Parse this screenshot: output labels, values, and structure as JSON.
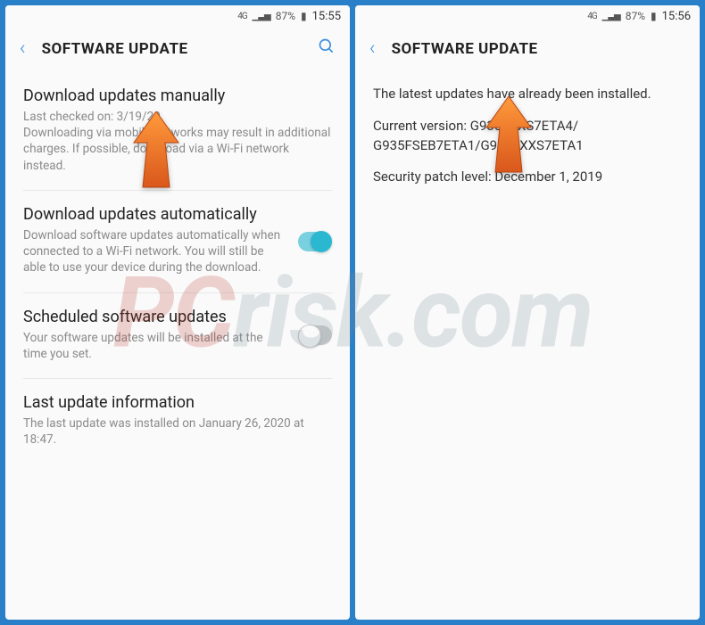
{
  "watermark": {
    "part1": "PC",
    "part2": "risk.com"
  },
  "left": {
    "status": {
      "network": "4G",
      "signal": "▁▃▅",
      "battery_pct": "87%",
      "battery_icon": "▮",
      "time": "15:55"
    },
    "header": {
      "title": "SOFTWARE UPDATE"
    },
    "items": {
      "manual": {
        "title": "Download updates manually",
        "sub": "Last checked on: 3/19/20\nDownloading via mobile networks may result in additional charges. If possible, download via a Wi-Fi network instead."
      },
      "auto": {
        "title": "Download updates automatically",
        "sub": "Download software updates automatically when connected to a Wi-Fi network. You will still be able to use your device during the download.",
        "toggle": "on"
      },
      "scheduled": {
        "title": "Scheduled software updates",
        "sub": "Your software updates will be installed at the time you set.",
        "toggle": "off"
      },
      "last": {
        "title": "Last update information",
        "sub": "The last update was installed on January 26, 2020 at 18:47."
      }
    }
  },
  "right": {
    "status": {
      "network": "4G",
      "signal": "▁▃▅",
      "battery_pct": "87%",
      "battery_icon": "▮",
      "time": "15:56"
    },
    "header": {
      "title": "SOFTWARE UPDATE"
    },
    "info": {
      "message": "The latest updates have already been installed.",
      "version_label": "Current version:",
      "version_lines": "G935FXXS7ETA4/\nG935FSEB7ETA1/G935FXXS7ETA1",
      "patch": "Security patch level: December 1, 2019"
    }
  }
}
